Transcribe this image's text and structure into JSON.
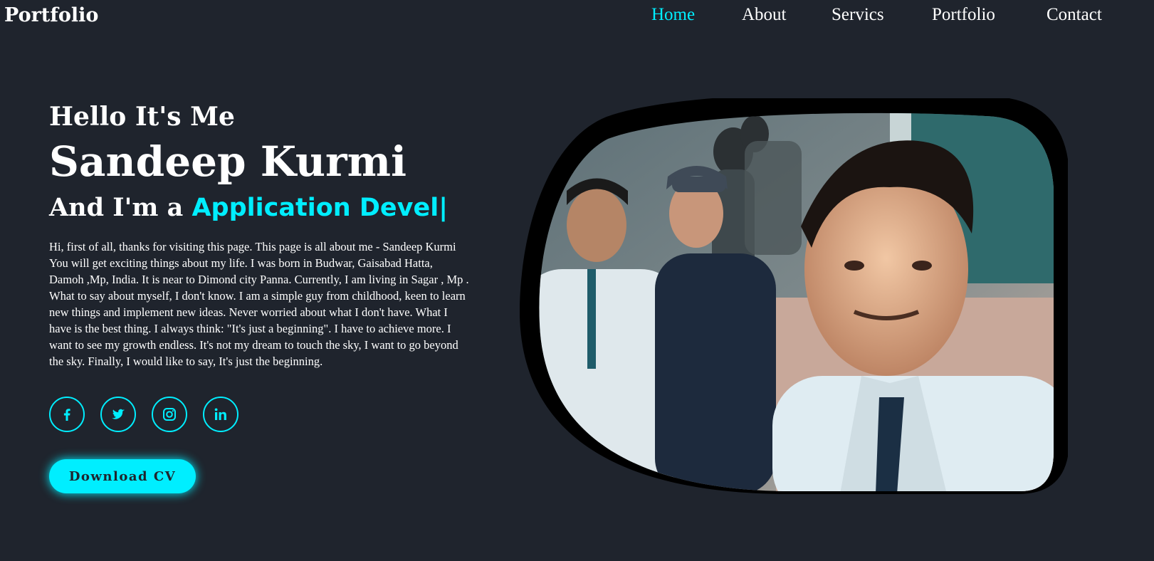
{
  "header": {
    "logo": "Portfolio",
    "nav": [
      {
        "label": "Home",
        "active": true
      },
      {
        "label": "About",
        "active": false
      },
      {
        "label": "Servics",
        "active": false
      },
      {
        "label": "Portfolio",
        "active": false
      },
      {
        "label": "Contact",
        "active": false
      }
    ]
  },
  "hero": {
    "greeting": "Hello It's Me",
    "name": "Sandeep Kurmi",
    "role_prefix": "And I'm a ",
    "role_typed": "Application Devel|",
    "bio": "Hi, first of all, thanks for visiting this page. This page is all about me - Sandeep Kurmi You will get exciting things about my life. I was born in Budwar, Gaisabad Hatta, Damoh ,Mp, India. It is near to Dimond city Panna. Currently, I am living in Sagar , Mp . What to say about myself, I don't know. I am a simple guy from childhood, keen to learn new things and implement new ideas. Never worried about what I don't have. What I have is the best thing. I always think: \"It's just a beginning\". I have to achieve more. I want to see my growth endless. It's not my dream to touch the sky, I want to go beyond the sky. Finally, I would like to say, It's just the beginning.",
    "social": [
      "facebook-icon",
      "twitter-icon",
      "instagram-icon",
      "linkedin-icon"
    ],
    "cta_label": "Download CV"
  },
  "colors": {
    "background": "#1f242d",
    "accent": "#00eeff",
    "text": "#ffffff"
  }
}
